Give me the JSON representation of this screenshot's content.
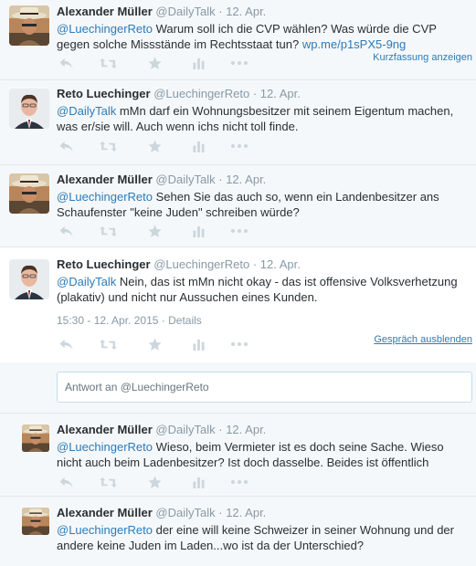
{
  "tweets": [
    {
      "name": "Alexander Müller",
      "handle": "@DailyTalk",
      "time": "12. Apr.",
      "mention": "@LuechingerReto",
      "text": " Warum soll ich die CVP wählen? Was würde die CVP gegen solche Missstände im Rechtsstaat tun? ",
      "link": "wp.me/p1sPX5-9ng",
      "side_link": "Kurzfassung anzeigen"
    },
    {
      "name": "Reto Luechinger",
      "handle": "@LuechingerReto",
      "time": "12. Apr.",
      "mention": "@DailyTalk",
      "text": " mMn darf ein Wohnungsbesitzer mit seinem Eigentum machen, was er/sie will. Auch wenn ichs nicht toll finde."
    },
    {
      "name": "Alexander Müller",
      "handle": "@DailyTalk",
      "time": "12. Apr.",
      "mention": "@LuechingerReto",
      "text": " Sehen Sie das auch so, wenn ein Landenbesitzer ans Schaufenster \"keine Juden\" schreiben würde?"
    },
    {
      "name": "Reto Luechinger",
      "handle": "@LuechingerReto",
      "time": "12. Apr.",
      "mention": "@DailyTalk",
      "text": " Nein, das ist mMn nicht okay - das ist offensive Volksverhetzung (plakativ) und nicht nur Aussuchen eines Kunden.",
      "timestamp": "15:30 - 12. Apr. 2015",
      "details": "Details",
      "side_link": "Gespräch ausblenden"
    },
    {
      "name": "Alexander Müller",
      "handle": "@DailyTalk",
      "time": "12. Apr.",
      "mention": "@LuechingerReto",
      "text": " Wieso, beim Vermieter ist es doch seine Sache. Wieso nicht auch beim Ladenbesitzer? Ist doch dasselbe. Beides ist öffentlich"
    },
    {
      "name": "Alexander Müller",
      "handle": "@DailyTalk",
      "time": "12. Apr.",
      "mention": "@LuechingerReto",
      "text": " der eine will keine Schweizer in seiner Wohnung und der andere keine Juden im Laden...wo ist da der Unterschied?"
    }
  ],
  "separator": "·",
  "reply_placeholder": "Antwort an @LuechingerReto",
  "icons": [
    "reply-icon",
    "retweet-icon",
    "favorite-icon",
    "stats-icon",
    "more-icon"
  ],
  "colors": {
    "link": "#2b7bb9",
    "muted": "#8899a6",
    "icon": "#ccd6dd",
    "text": "#292f33"
  }
}
